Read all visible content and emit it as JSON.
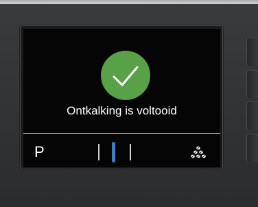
{
  "display": {
    "message": "Ontkalking is voltooid",
    "status_icon": "checkmark-icon",
    "status_color": "#58a146"
  },
  "softkeys": {
    "left_label": "P",
    "center_icon": "position-indicator-icon",
    "center_color": "#3c7fc0",
    "right_icon": "coffee-beans-icon"
  }
}
